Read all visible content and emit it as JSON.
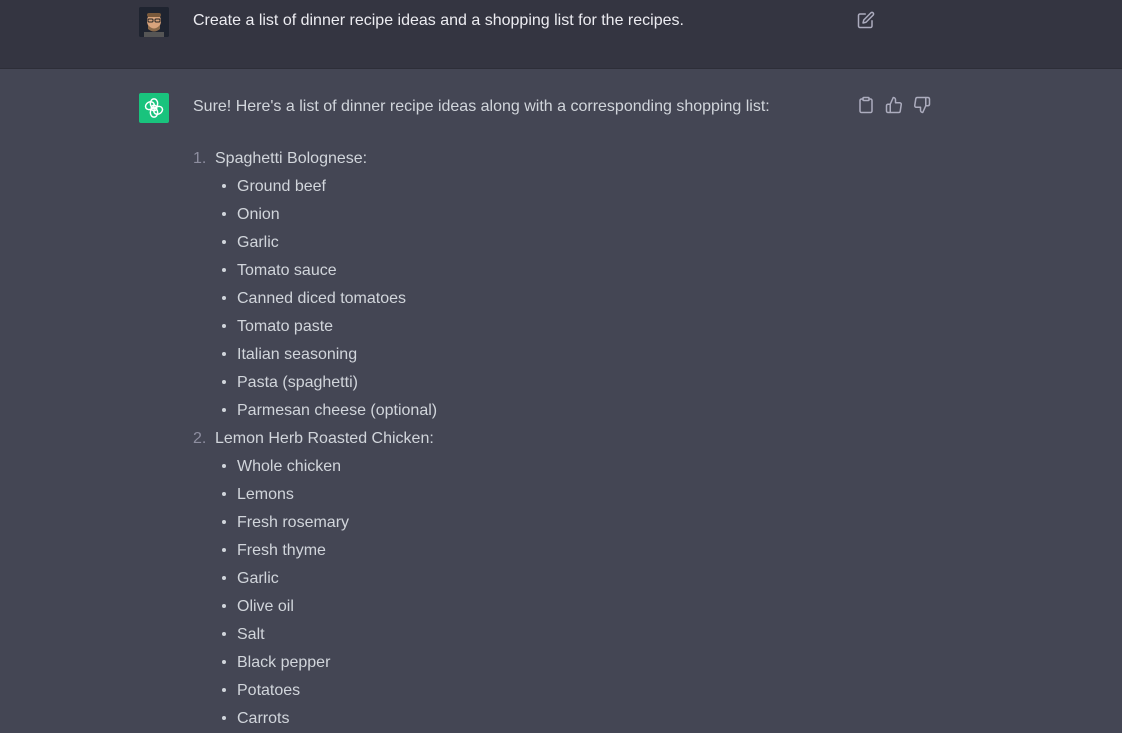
{
  "user_message": {
    "text": "Create a list of dinner recipe ideas and a shopping list for the recipes."
  },
  "assistant_message": {
    "intro": "Sure! Here's a list of dinner recipe ideas along with a corresponding shopping list:",
    "recipes": [
      {
        "number": "1.",
        "title": "Spaghetti Bolognese:",
        "ingredients": [
          "Ground beef",
          "Onion",
          "Garlic",
          "Tomato sauce",
          "Canned diced tomatoes",
          "Tomato paste",
          "Italian seasoning",
          "Pasta (spaghetti)",
          "Parmesan cheese (optional)"
        ]
      },
      {
        "number": "2.",
        "title": "Lemon Herb Roasted Chicken:",
        "ingredients": [
          "Whole chicken",
          "Lemons",
          "Fresh rosemary",
          "Fresh thyme",
          "Garlic",
          "Olive oil",
          "Salt",
          "Black pepper",
          "Potatoes",
          "Carrots"
        ]
      }
    ]
  },
  "icons": {
    "edit": "edit-icon",
    "copy": "clipboard-icon",
    "thumbs_up": "thumbs-up-icon",
    "thumbs_down": "thumbs-down-icon",
    "assistant_logo": "openai-logo-icon"
  },
  "colors": {
    "user_bg": "#343541",
    "assistant_bg": "#444654",
    "assistant_avatar": "#19c37d"
  }
}
